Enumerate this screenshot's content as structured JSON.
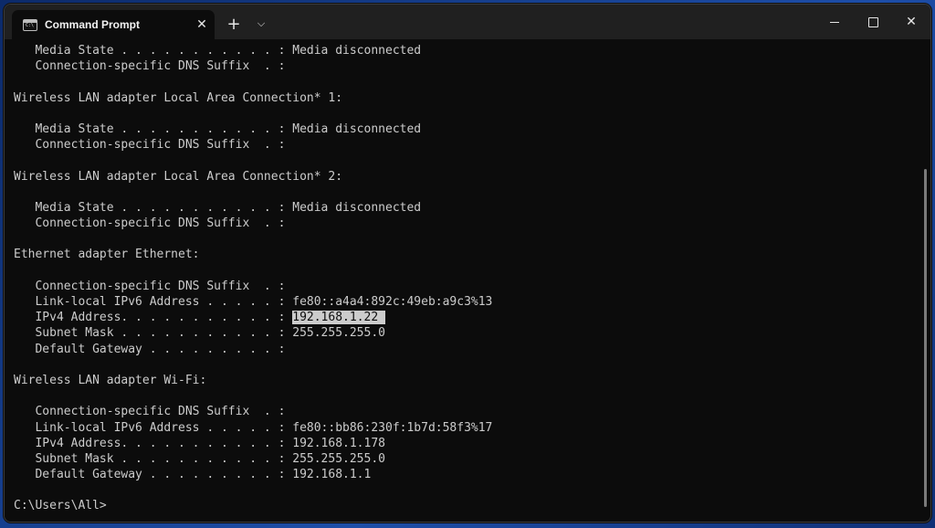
{
  "window": {
    "tab_title": "Command Prompt",
    "tab_close": "✕",
    "new_tab": "+",
    "dropdown": "⌵",
    "close_window": "✕"
  },
  "terminal": {
    "lines": [
      {
        "text": "   Media State . . . . . . . . . . . : Media disconnected"
      },
      {
        "text": "   Connection-specific DNS Suffix  . :"
      },
      {
        "text": ""
      },
      {
        "text": "Wireless LAN adapter Local Area Connection* 1:"
      },
      {
        "text": ""
      },
      {
        "text": "   Media State . . . . . . . . . . . : Media disconnected"
      },
      {
        "text": "   Connection-specific DNS Suffix  . :"
      },
      {
        "text": ""
      },
      {
        "text": "Wireless LAN adapter Local Area Connection* 2:"
      },
      {
        "text": ""
      },
      {
        "text": "   Media State . . . . . . . . . . . : Media disconnected"
      },
      {
        "text": "   Connection-specific DNS Suffix  . :"
      },
      {
        "text": ""
      },
      {
        "text": "Ethernet adapter Ethernet:"
      },
      {
        "text": ""
      },
      {
        "text": "   Connection-specific DNS Suffix  . :"
      },
      {
        "text": "   Link-local IPv6 Address . . . . . : fe80::a4a4:892c:49eb:a9c3%13"
      },
      {
        "text": "   IPv4 Address. . . . . . . . . . . : ",
        "selected": "192.168.1.22 "
      },
      {
        "text": "   Subnet Mask . . . . . . . . . . . : 255.255.255.0"
      },
      {
        "text": "   Default Gateway . . . . . . . . . :"
      },
      {
        "text": ""
      },
      {
        "text": "Wireless LAN adapter Wi-Fi:"
      },
      {
        "text": ""
      },
      {
        "text": "   Connection-specific DNS Suffix  . :"
      },
      {
        "text": "   Link-local IPv6 Address . . . . . : fe80::bb86:230f:1b7d:58f3%17"
      },
      {
        "text": "   IPv4 Address. . . . . . . . . . . : 192.168.1.178"
      },
      {
        "text": "   Subnet Mask . . . . . . . . . . . : 255.255.255.0"
      },
      {
        "text": "   Default Gateway . . . . . . . . . : 192.168.1.1"
      },
      {
        "text": ""
      },
      {
        "text": "C:\\Users\\All>"
      }
    ]
  },
  "colors": {
    "terminal_bg": "#0c0c0c",
    "terminal_fg": "#cccccc",
    "titlebar_bg": "#202020",
    "selection_bg": "#cccccc"
  }
}
